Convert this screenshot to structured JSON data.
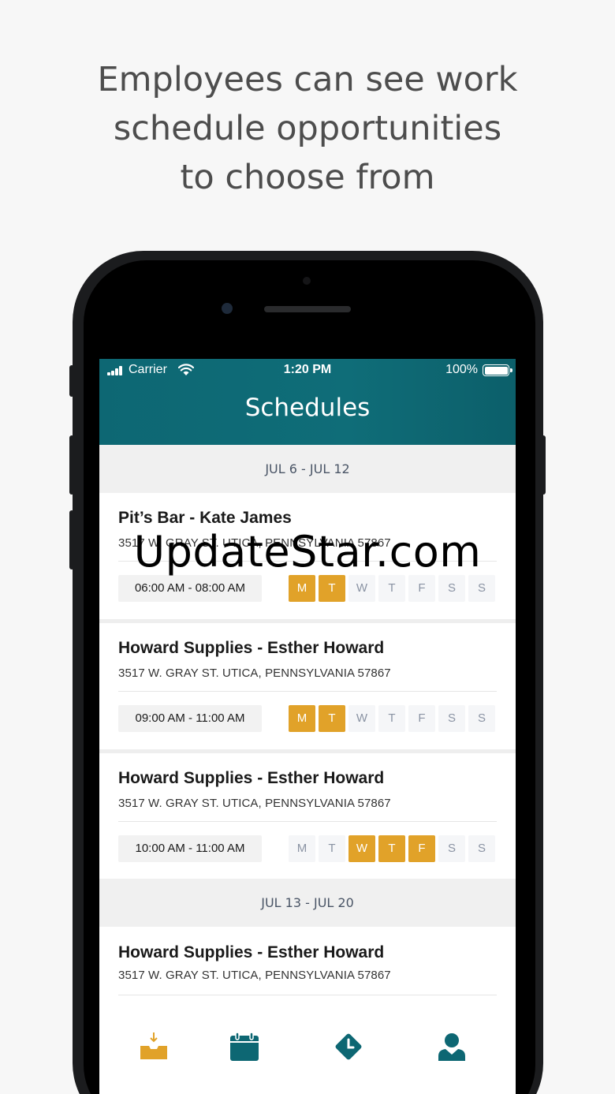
{
  "headline": {
    "line1": "Employees can see work",
    "line2": "schedule opportunities",
    "line3": "to choose from"
  },
  "status_bar": {
    "carrier": "Carrier",
    "time": "1:20 PM",
    "battery": "100%"
  },
  "app": {
    "title": "Schedules"
  },
  "weeks": [
    {
      "label": "JUL 6 - JUL 12",
      "schedules": [
        {
          "name": "Pit’s Bar - Kate James",
          "address": "3517 W. GRAY ST. UTICA, PENNSYLVANIA 57867",
          "time": "06:00 AM - 08:00 AM",
          "days": [
            "M",
            "T",
            "W",
            "T",
            "F",
            "S",
            "S"
          ],
          "active": [
            true,
            true,
            false,
            false,
            false,
            false,
            false
          ]
        },
        {
          "name": "Howard Supplies - Esther Howard",
          "address": "3517 W. GRAY ST. UTICA, PENNSYLVANIA 57867",
          "time": "09:00 AM - 11:00 AM",
          "days": [
            "M",
            "T",
            "W",
            "T",
            "F",
            "S",
            "S"
          ],
          "active": [
            true,
            true,
            false,
            false,
            false,
            false,
            false
          ]
        },
        {
          "name": "Howard Supplies - Esther Howard",
          "address": "3517 W. GRAY ST. UTICA, PENNSYLVANIA 57867",
          "time": "10:00 AM - 11:00 AM",
          "days": [
            "M",
            "T",
            "W",
            "T",
            "F",
            "S",
            "S"
          ],
          "active": [
            false,
            false,
            true,
            true,
            true,
            false,
            false
          ]
        }
      ]
    },
    {
      "label": "JUL 13 - JUL 20",
      "schedules": [
        {
          "name": "Howard Supplies - Esther Howard",
          "address": "3517 W. GRAY ST. UTICA, PENNSYLVANIA 57867"
        }
      ]
    }
  ],
  "tabs": [
    {
      "icon": "inbox-download-icon",
      "color": "#e1a229"
    },
    {
      "icon": "calendar-icon",
      "color": "#0d6773"
    },
    {
      "icon": "clock-icon",
      "color": "#0d6773"
    },
    {
      "icon": "user-icon",
      "color": "#0d6773"
    }
  ],
  "watermark": "UpdateStar.com",
  "colors": {
    "accent": "#e1a229",
    "primary": "#0d6773"
  }
}
